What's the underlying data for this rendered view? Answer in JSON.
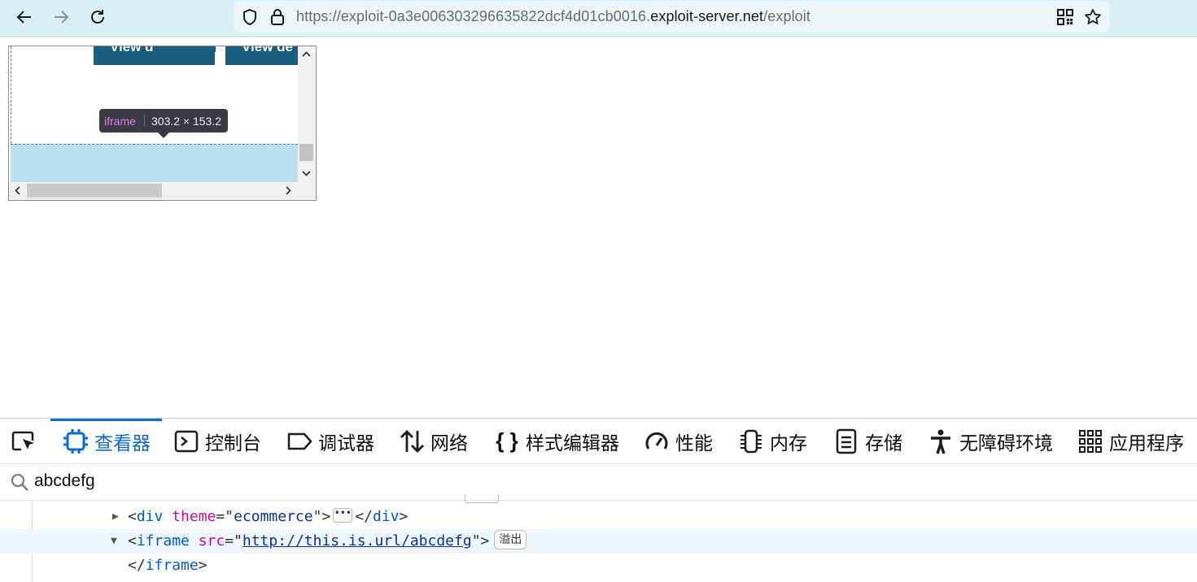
{
  "browser": {
    "url": {
      "prefix": "https://exploit-0a3e00630329663582 2dcf4d01cb0016.",
      "full_prefix": "https://exploit-0a3e006303296635822dcf4d01cb0016.",
      "domain": "exploit-server.net",
      "path": "/exploit"
    },
    "icons": [
      "back-arrow-icon",
      "forward-arrow-icon",
      "reload-icon",
      "shield-icon",
      "lock-icon",
      "qr-code-icon",
      "bookmark-star-icon"
    ]
  },
  "page": {
    "buttons": [
      "View d",
      "View de"
    ],
    "tooltip": {
      "tag": "iframe",
      "dimensions": "303.2 × 153.2"
    }
  },
  "devtools": {
    "tabs": [
      {
        "label": "",
        "icon": "element-picker-icon"
      },
      {
        "label": "查看器",
        "icon": "inspector-icon",
        "active": true
      },
      {
        "label": "控制台",
        "icon": "console-icon"
      },
      {
        "label": "调试器",
        "icon": "debugger-icon"
      },
      {
        "label": "网络",
        "icon": "network-icon"
      },
      {
        "label": "样式编辑器",
        "icon": "style-editor-icon"
      },
      {
        "label": "性能",
        "icon": "performance-icon"
      },
      {
        "label": "内存",
        "icon": "memory-icon"
      },
      {
        "label": "存储",
        "icon": "storage-icon"
      },
      {
        "label": "无障碍环境",
        "icon": "accessibility-icon"
      },
      {
        "label": "应用程序",
        "icon": "application-icon"
      }
    ],
    "search": {
      "value": "abcdefg"
    },
    "tree": {
      "row1": {
        "open": "<",
        "tag": "div",
        "attr": "theme",
        "eq": "=\"",
        "value": "ecommerce",
        "close_q": "\">",
        "ellipsis": "•••",
        "end": "</",
        "end_tag": "div",
        "gt": ">"
      },
      "row2": {
        "open": "<",
        "tag": "iframe",
        "attr": "src",
        "eq": "=\"",
        "value": "http://this.is.url/abcdefg",
        "close_q": "\">",
        "badge": "溢出"
      },
      "row3": {
        "end": "</",
        "end_tag": "iframe",
        "gt": ">"
      }
    }
  }
}
